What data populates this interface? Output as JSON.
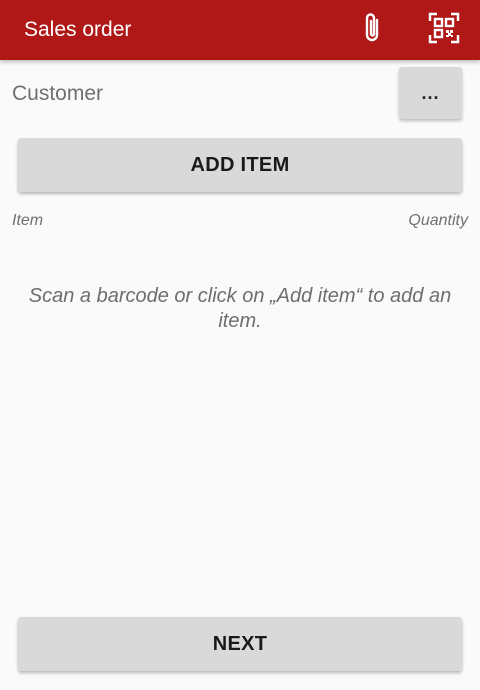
{
  "toolbar": {
    "title": "Sales order",
    "icons": [
      "paperclip-icon",
      "qr-code-icon"
    ],
    "background_color": "#b01818"
  },
  "customer": {
    "label": "Customer",
    "picker_label": "..."
  },
  "actions": {
    "add_item_label": "ADD ITEM",
    "next_label": "NEXT"
  },
  "list": {
    "columns": [
      "Item",
      "Quantity"
    ],
    "empty_message": "Scan a barcode or click on „Add item“ to add an item."
  }
}
